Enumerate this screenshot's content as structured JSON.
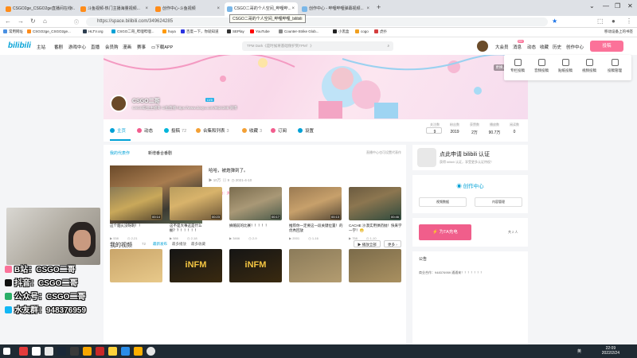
{
  "browser": {
    "tabs": [
      {
        "label": "CSGO2ge_CSGO2ge直播间在线...",
        "active": false
      },
      {
        "label": "斗鱼视频-热门主播海量视频...",
        "active": false
      },
      {
        "label": "创作中心-斗鱼视频",
        "active": false
      },
      {
        "label": "CSGO二哥的个人空间_哔哩哔...",
        "active": true
      },
      {
        "label": "创作中心 - 哔哩哔哩弹幕视频...",
        "active": false
      }
    ],
    "tooltip": "CSGO二哥的个人空间_哔哩哔哩_bilibili",
    "url": "https://space.bilibili.com/349624285",
    "bookmarks": [
      "常用网址",
      "CSGO2ge_CSGO2ge...",
      "HLTV.org",
      "CSGO二哥_哔哩哔哩...",
      "huya",
      "百度一下，你就知道",
      "SEPlay",
      "YouTube",
      "Counter-Strike Glob...",
      "小黑盒",
      "cogo",
      "虎扑"
    ],
    "bookmarks_other": "移动设备上的书签"
  },
  "site": {
    "logo": "bilibili",
    "nav": [
      "主站",
      "番剧",
      "游戏中心",
      "直播",
      "会员购",
      "漫画",
      "赛事",
      "下载APP"
    ],
    "search_placeholder": "TPM Dark《是时候将基础保护到TPM！》",
    "right_nav": [
      "大会员",
      "消息",
      "动态",
      "收藏",
      "历史",
      "创作中心"
    ],
    "msg_badge": "99+",
    "upload": "投稿",
    "upload_menu": [
      "专栏投稿",
      "音频投稿",
      "贴纸投稿",
      "视频投稿",
      "投稿管理"
    ]
  },
  "profile": {
    "name": "CSGO二哥",
    "level": "LV6",
    "sign": "CSGO职业主播哥 斗鱼直播 https://www.douyu.com/9624285 微博",
    "banner_link": "更换、我的头图",
    "tabs": [
      {
        "label": "主页",
        "count": "",
        "color": "#00a1d6"
      },
      {
        "label": "动态",
        "count": "",
        "color": "#f25d8e"
      },
      {
        "label": "投稿",
        "count": "72",
        "color": "#02b5da"
      },
      {
        "label": "合集和列表",
        "count": "3",
        "color": "#f3a034"
      },
      {
        "label": "收藏",
        "count": "3",
        "color": "#f3a034"
      },
      {
        "label": "订阅",
        "count": "",
        "color": "#f25d8e"
      },
      {
        "label": "设置",
        "count": "",
        "color": "#00a1d6"
      }
    ],
    "stats": [
      {
        "label": "关注数",
        "value": "9"
      },
      {
        "label": "粉丝数",
        "value": "2019"
      },
      {
        "label": "获赞数",
        "value": "2万"
      },
      {
        "label": "播放数",
        "value": "90.7万"
      },
      {
        "label": "阅读数",
        "value": "0"
      }
    ]
  },
  "main": {
    "subtabs": [
      "我的代表作",
      "新增番合番剧"
    ],
    "hint": "直播中心也可设置代表作",
    "featured": {
      "title": "哈哈，被炮弹到了。",
      "views": "10万",
      "comments": "9",
      "date": "2021-4-10",
      "comment_label": "推荐理由：太刺激。"
    },
    "my_videos_title": "我的视频",
    "my_videos_count": "72",
    "video_tabs": [
      "最新发布",
      "最多播放",
      "最多收藏"
    ],
    "btn_play_all": "播放全部",
    "btn_more": "更多",
    "videos": [
      {
        "title": "这个烟火没呀刺！！",
        "duration": "00:14",
        "views": "538",
        "date": "2-21"
      },
      {
        "title": "这不是大事这是什么橱？？！！！！！",
        "duration": "00:23",
        "views": "586",
        "date": "2-18"
      },
      {
        "title": "摘帽前的比赛！！！！！",
        "duration": "00:17",
        "views": "3466",
        "date": "2-9"
      },
      {
        "title": "推荐你一定要这一段关键位置！的优秀回放",
        "duration": "00:13",
        "views": "2001",
        "date": "1-16"
      },
      {
        "title": "CACHE 沙漠实用弹药抛！快来学一学！😁",
        "duration": "00:46",
        "views": "758",
        "date": "1-10"
      },
      {
        "title": "",
        "duration": "",
        "views": "",
        "date": ""
      },
      {
        "title": "iNFM",
        "duration": "",
        "views": "",
        "date": ""
      },
      {
        "title": "iNFM",
        "duration": "",
        "views": "",
        "date": ""
      },
      {
        "title": "",
        "duration": "",
        "views": "",
        "date": ""
      },
      {
        "title": "",
        "duration": "",
        "views": "",
        "date": ""
      }
    ]
  },
  "right": {
    "cert_title": "点此申请 bilibili 认证",
    "cert_sub": "获得 bilibili 认证，享受更多认证特权！",
    "create_center": "创作中心",
    "btn_video_data": "视频数据",
    "btn_content_mgmt": "内容管理",
    "charge_btn": "为TA充电",
    "charge_count": "共 2 人",
    "notice_title": "公告",
    "notice_text": "商业合作：948376959  通通来！！！！！！！"
  },
  "stream_overlay": {
    "lines": [
      {
        "text": "B站：CSGO二哥",
        "icon_color": "#fb7299"
      },
      {
        "text": "抖音：CSGO二哥",
        "icon_color": "#111111"
      },
      {
        "text": "公众号：CSGO二哥",
        "icon_color": "#2aae67"
      },
      {
        "text": "水友群：948376959",
        "icon_color": "#12b7f5"
      }
    ]
  },
  "taskbar": {
    "time": "22:09",
    "date": "2022/2/24",
    "tray": "英"
  }
}
